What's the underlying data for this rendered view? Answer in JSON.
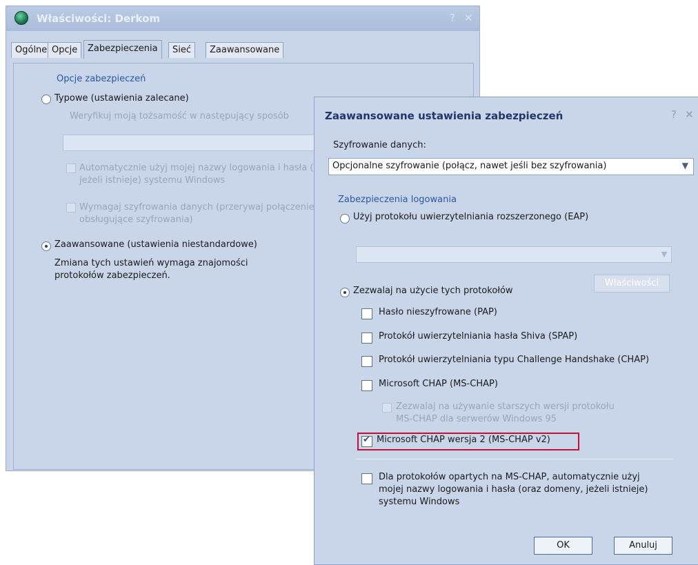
{
  "back_window": {
    "title": "Właściwości: Derkom",
    "help_glyph": "?",
    "close_glyph": "✕",
    "tabs": [
      "Ogólne",
      "Opcje",
      "Zabezpieczenia",
      "Sieć",
      "Zaawansowane"
    ],
    "active_tab": "Zabezpieczenia",
    "security_options_label": "Opcje zabezpieczeń",
    "typical_radio": "Typowe (ustawienia zalecane)",
    "validation_label": "Weryfikuj moją tożsamość w następujący sposób",
    "auto_login_line1": "Automatycznie użyj mojej nazwy logowania i hasła (i domeny,",
    "auto_login_line2": "jeżeli istnieje) systemu Windows",
    "require_encryption_line1": "Wymagaj szyfrowania danych (przerywaj połączenie, jeśli nie",
    "require_encryption_line2": "obsługujące szyfrowania)",
    "advanced_radio": "Zaawansowane (ustawienia niestandardowe)",
    "advanced_desc_line1": "Zmiana tych ustawień wymaga znajomości",
    "advanced_desc_line2": "protokołów zabezpieczeń."
  },
  "front_dialog": {
    "title": "Zaawansowane ustawienia zabezpieczeń",
    "help_glyph": "?",
    "close_glyph": "✕",
    "data_encryption_label": "Szyfrowanie danych:",
    "data_encryption_value": "Opcjonalne szyfrowanie (połącz, nawet jeśli bez szyfrowania)",
    "login_security_label": "Zabezpieczenia logowania",
    "eap_radio": "Użyj protokołu uwierzytelniania rozszerzonego (EAP)",
    "properties_button": "Właściwości",
    "allow_protocols_radio": "Zezwalaj na użycie tych protokołów",
    "protocols": [
      {
        "label": "Hasło nieszyfrowane (PAP)",
        "checked": false
      },
      {
        "label": "Protokół uwierzytelniania hasła Shiva (SPAP)",
        "checked": false
      },
      {
        "label": "Protokół uwierzytelniania typu Challenge Handshake (CHAP)",
        "checked": false
      },
      {
        "label": "Microsoft CHAP (MS-CHAP)",
        "checked": false
      }
    ],
    "legacy_ms_chap_line1": "Zezwalaj na używanie starszych wersji protokołu",
    "legacy_ms_chap_line2": "MS-CHAP dla serwerów Windows 95",
    "ms_chap_v2": {
      "label": "Microsoft CHAP wersja 2 (MS-CHAP v2)",
      "checked": true
    },
    "auto_credentials_line1": "Dla protokołów opartych na MS-CHAP, automatycznie użyj",
    "auto_credentials_line2": "mojej nazwy logowania i hasła (oraz domeny, jeżeli istnieje)",
    "auto_credentials_line3": "systemu Windows",
    "ok_button": "OK",
    "cancel_button": "Anuluj"
  }
}
